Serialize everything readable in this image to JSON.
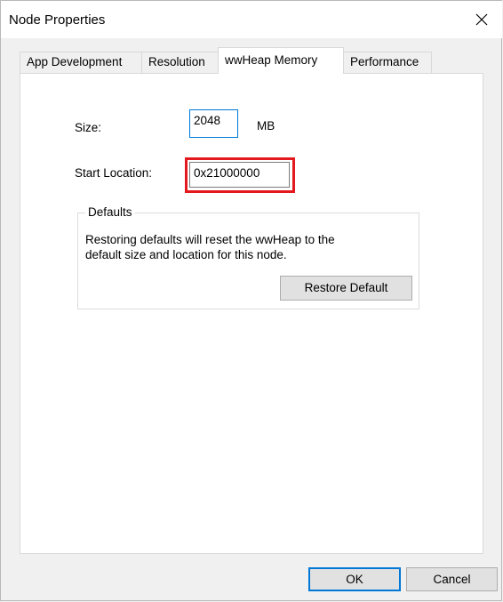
{
  "window": {
    "title": "Node Properties"
  },
  "tabs": [
    {
      "label": "App Development"
    },
    {
      "label": "Resolution"
    },
    {
      "label": "wwHeap Memory"
    },
    {
      "label": "Performance"
    }
  ],
  "active_tab": "wwHeap Memory",
  "size": {
    "label": "Size:",
    "value": "2048",
    "unit": "MB"
  },
  "start_location": {
    "label": "Start Location:",
    "value": "0x21000000"
  },
  "defaults": {
    "caption": "Defaults",
    "text_line1": "Restoring defaults will reset the wwHeap to the",
    "text_line2": "default size and location for this node.",
    "button_label": "Restore Default"
  },
  "footer": {
    "ok_label": "OK",
    "cancel_label": "Cancel"
  },
  "colors": {
    "highlight": "#e3191d",
    "focus": "#0078d7"
  }
}
